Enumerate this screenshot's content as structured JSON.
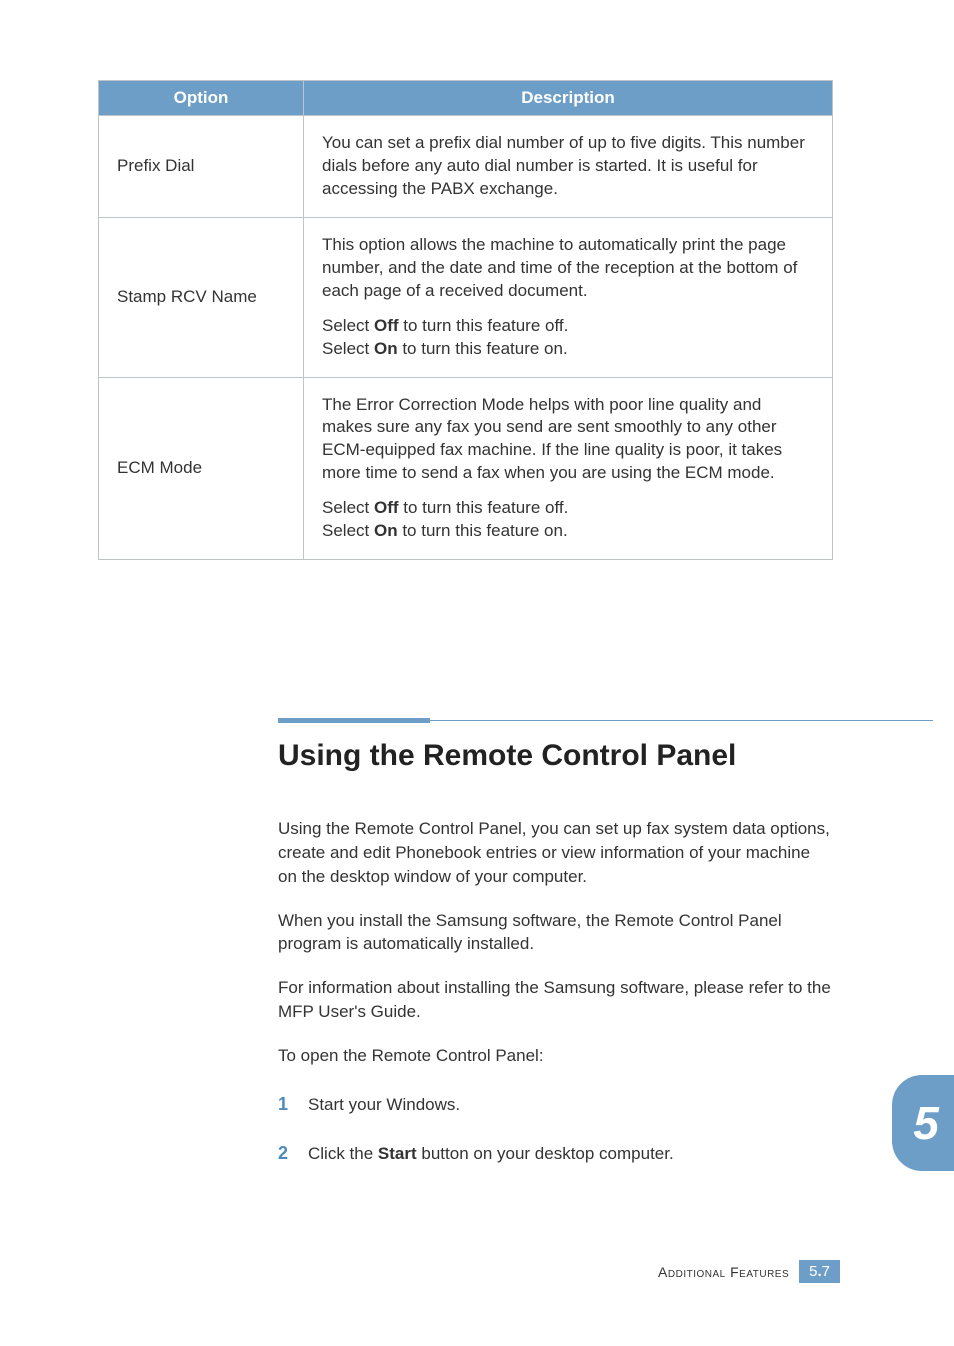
{
  "table": {
    "headers": {
      "option": "Option",
      "description": "Description"
    },
    "rows": [
      {
        "option": "Prefix Dial",
        "description": "You can set a prefix dial number of up to five digits. This number dials before any auto dial number is started. It is useful for accessing the PABX exchange."
      },
      {
        "option": "Stamp RCV Name",
        "desc_main": "This option allows the machine to automatically print the page number, and the date and time of the reception at the bottom of each page of a received document.",
        "select_off_pre": "Select ",
        "select_off_bold": "Off",
        "select_off_post": " to turn this feature off.",
        "select_on_pre": "Select ",
        "select_on_bold": "On",
        "select_on_post": " to turn this feature on."
      },
      {
        "option": "ECM Mode",
        "desc_main": "The Error Correction Mode helps with poor line quality and makes sure any fax you send are sent smoothly to any other ECM-equipped fax machine. If the line quality is poor, it takes more time to send a fax when you are using the ECM mode.",
        "select_off_pre": "Select ",
        "select_off_bold": "Off",
        "select_off_post": " to turn this feature off.",
        "select_on_pre": "Select ",
        "select_on_bold": "On",
        "select_on_post": " to turn this feature on."
      }
    ]
  },
  "section": {
    "heading": "Using the Remote Control Panel",
    "p1": "Using the Remote Control Panel, you can set up fax system data options, create and edit Phonebook entries or view information of your machine on the desktop window of your computer.",
    "p2": "When you install the Samsung software, the Remote Control Panel program is automatically installed.",
    "p3": "For information about installing the Samsung software, please refer to the MFP User's Guide.",
    "p4": "To open the Remote Control Panel:"
  },
  "steps": [
    {
      "num": "1",
      "text": "Start your Windows."
    },
    {
      "num": "2",
      "pre": "Click the ",
      "bold": "Start",
      "post": " button on your desktop computer."
    }
  ],
  "chapter_tab": "5",
  "footer": {
    "label": "Additional Features",
    "chapter": "5",
    "page": "7"
  }
}
